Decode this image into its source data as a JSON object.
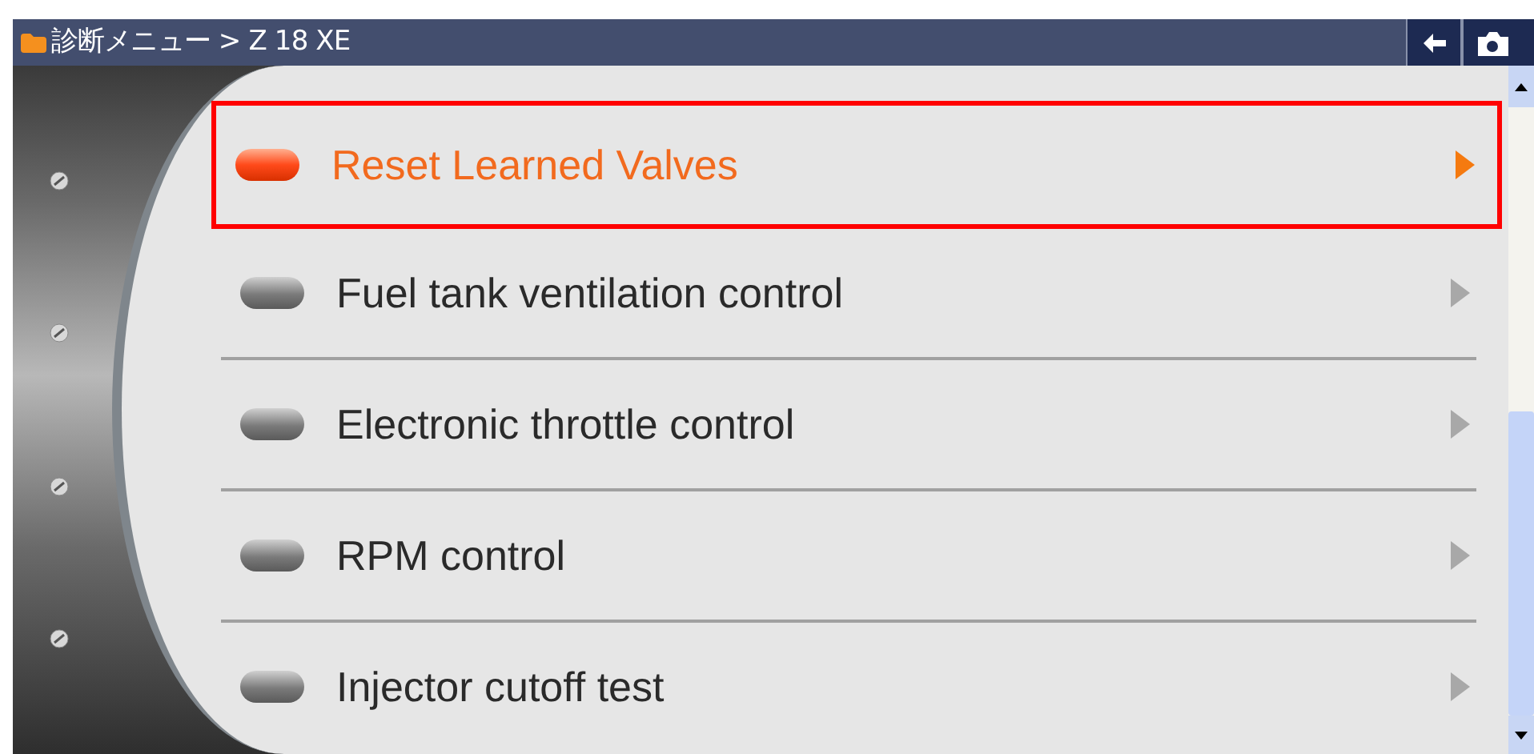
{
  "title_bar": {
    "breadcrumb": "診断メニュー > Z 18 XE"
  },
  "menu": {
    "items": [
      {
        "label": "Reset Learned Valves",
        "selected": true
      },
      {
        "label": "Fuel tank ventilation control",
        "selected": false
      },
      {
        "label": "Electronic throttle control",
        "selected": false
      },
      {
        "label": "RPM control",
        "selected": false
      },
      {
        "label": "Injector cutoff test",
        "selected": false
      }
    ]
  }
}
